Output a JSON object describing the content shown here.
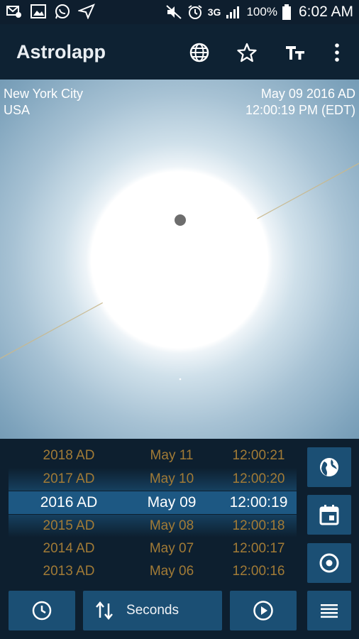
{
  "status_bar": {
    "left_icons": [
      "email-notification-icon",
      "image-icon",
      "whatsapp-icon",
      "vpn-send-icon"
    ],
    "right_icons": [
      "mute-icon",
      "alarm-icon"
    ],
    "network": "3G",
    "battery": "100%",
    "time": "6:02 AM"
  },
  "app_bar": {
    "title": "Astrolapp",
    "actions": [
      "globe-icon",
      "star-icon",
      "text-size-icon",
      "more-vert-icon"
    ]
  },
  "sky_view": {
    "location_city": "New York City",
    "location_country": "USA",
    "date": "May 09 2016 AD",
    "time": "12:00:19 PM (EDT)"
  },
  "time_picker": {
    "rows": [
      {
        "year": "2018 AD",
        "date": "May 11",
        "time": "12:00:21"
      },
      {
        "year": "2017 AD",
        "date": "May 10",
        "time": "12:00:20"
      },
      {
        "year": "2016 AD",
        "date": "May 09",
        "time": "12:00:19"
      },
      {
        "year": "2015 AD",
        "date": "May 08",
        "time": "12:00:18"
      },
      {
        "year": "2014 AD",
        "date": "May 07",
        "time": "12:00:17"
      },
      {
        "year": "2013 AD",
        "date": "May 06",
        "time": "12:00:16"
      }
    ],
    "selected_index": 2
  },
  "side_buttons": [
    "globe-icon",
    "calendar-icon",
    "target-icon"
  ],
  "bottom_bar": {
    "step_label": "Seconds",
    "icons": [
      "clock-icon",
      "swap-vertical-icon",
      "play-icon",
      "menu-icon"
    ]
  },
  "colors": {
    "accent_button": "#1b4f74",
    "picker_dim_text": "#a27b36",
    "selected_row": "#1d5883"
  }
}
